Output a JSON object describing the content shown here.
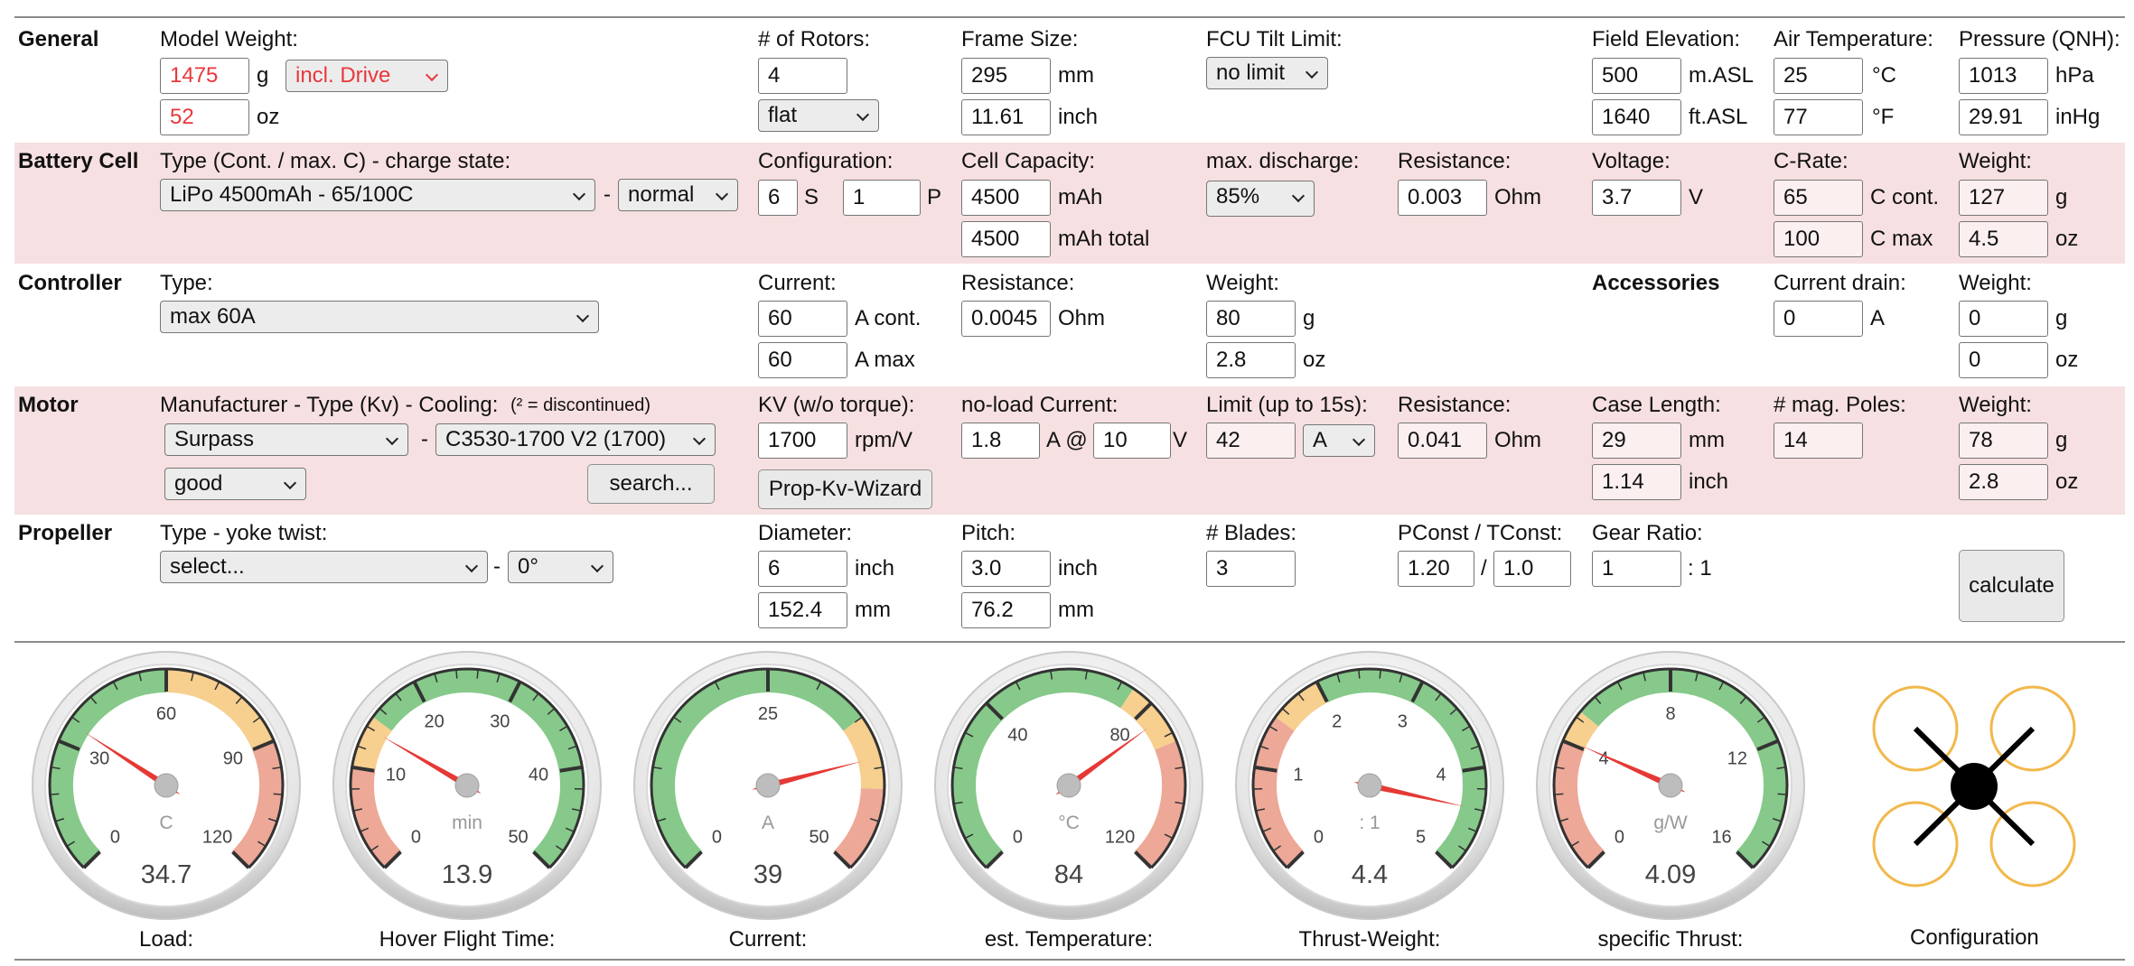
{
  "general": {
    "section": "General",
    "model_weight_label": "Model Weight:",
    "weight_g": "1475",
    "unit_g": "g",
    "drive_select": "incl. Drive",
    "weight_oz": "52",
    "unit_oz": "oz",
    "rotors_label": "# of Rotors:",
    "rotors": "4",
    "arrangement": "flat",
    "frame_label": "Frame Size:",
    "frame_mm": "295",
    "unit_mm": "mm",
    "frame_inch": "11.61",
    "unit_inch": "inch",
    "tilt_label": "FCU Tilt Limit:",
    "tilt": "no limit",
    "elev_label": "Field Elevation:",
    "elev_m": "500",
    "unit_m": "m.ASL",
    "elev_ft": "1640",
    "unit_ft": "ft.ASL",
    "temp_label": "Air Temperature:",
    "temp_c": "25",
    "unit_c": "°C",
    "temp_f": "77",
    "unit_f": "°F",
    "press_label": "Pressure (QNH):",
    "press_hpa": "1013",
    "unit_hpa": "hPa",
    "press_inhg": "29.91",
    "unit_inhg": "inHg"
  },
  "battery": {
    "section": "Battery Cell",
    "type_label": "Type (Cont. / max. C) - charge state:",
    "type": "LiPo 4500mAh - 65/100C",
    "dash": "-",
    "state": "normal",
    "config_label": "Configuration:",
    "s": "6",
    "s_unit": "S",
    "p": "1",
    "p_unit": "P",
    "cap_label": "Cell Capacity:",
    "cap": "4500",
    "cap_unit": "mAh",
    "cap_total": "4500",
    "cap_total_unit": "mAh total",
    "discharge_label": "max. discharge:",
    "discharge": "85%",
    "res_label": "Resistance:",
    "res": "0.003",
    "res_unit": "Ohm",
    "volt_label": "Voltage:",
    "volt": "3.7",
    "volt_unit": "V",
    "crate_label": "C-Rate:",
    "c_cont": "65",
    "c_cont_unit": "C cont.",
    "c_max": "100",
    "c_max_unit": "C max",
    "weight_label": "Weight:",
    "weight_g": "127",
    "unit_g": "g",
    "weight_oz": "4.5",
    "unit_oz": "oz"
  },
  "controller": {
    "section": "Controller",
    "type_label": "Type:",
    "type": "max 60A",
    "current_label": "Current:",
    "cont": "60",
    "cont_unit": "A cont.",
    "max": "60",
    "max_unit": "A max",
    "res_label": "Resistance:",
    "res": "0.0045",
    "res_unit": "Ohm",
    "weight_label": "Weight:",
    "weight_g": "80",
    "unit_g": "g",
    "weight_oz": "2.8",
    "unit_oz": "oz",
    "acc_section": "Accessories",
    "drain_label": "Current drain:",
    "drain": "0",
    "drain_unit": "A",
    "acc_weight_label": "Weight:",
    "acc_weight_g": "0",
    "acc_unit_g": "g",
    "acc_weight_oz": "0",
    "acc_unit_oz": "oz"
  },
  "motor": {
    "section": "Motor",
    "type_label": "Manufacturer - Type (Kv) - Cooling:",
    "discontinued_note": "(² = discontinued)",
    "manufacturer": "Surpass",
    "dash": "-",
    "type": "C3530-1700 V2 (1700)",
    "cooling": "good",
    "search_button": "search...",
    "kv_label": "KV (w/o torque):",
    "kv": "1700",
    "kv_unit": "rpm/V",
    "prop_kv_wizard": "Prop-Kv-Wizard",
    "noload_label": "no-load Current:",
    "noload": "1.8",
    "noload_at": "A @",
    "noload_v": "10",
    "noload_v_unit": "V",
    "limit_label": "Limit (up to 15s):",
    "limit": "42",
    "limit_unit": "A",
    "res_label": "Resistance:",
    "res": "0.041",
    "res_unit": "Ohm",
    "case_label": "Case Length:",
    "case_mm": "29",
    "unit_mm": "mm",
    "case_inch": "1.14",
    "unit_inch": "inch",
    "poles_label": "# mag. Poles:",
    "poles": "14",
    "weight_label": "Weight:",
    "weight_g": "78",
    "unit_g": "g",
    "weight_oz": "2.8",
    "unit_oz": "oz"
  },
  "propeller": {
    "section": "Propeller",
    "type_label": "Type - yoke twist:",
    "type": "select...",
    "dash": "-",
    "twist": "0°",
    "diam_label": "Diameter:",
    "diam_inch": "6",
    "unit_inch": "inch",
    "diam_mm": "152.4",
    "unit_mm": "mm",
    "pitch_label": "Pitch:",
    "pitch_inch": "3.0",
    "pitch_mm": "76.2",
    "blades_label": "# Blades:",
    "blades": "3",
    "pconst_label": "PConst / TConst:",
    "pconst": "1.20",
    "slash": "/",
    "tconst": "1.0",
    "gear_label": "Gear Ratio:",
    "gear": "1",
    "gear_unit": ": 1",
    "calculate": "calculate"
  },
  "gauges": [
    {
      "label": "Load:",
      "unit": "C",
      "value": "34.7",
      "val": 34.7,
      "min": 0,
      "max": 120,
      "ticks": [
        0,
        30,
        60,
        90,
        120
      ],
      "bands": [
        {
          "from": 0,
          "to": 60,
          "color": "#86c98a"
        },
        {
          "from": 60,
          "to": 90,
          "color": "#f7cf8f"
        },
        {
          "from": 90,
          "to": 120,
          "color": "#eda898"
        }
      ]
    },
    {
      "label": "Hover Flight Time:",
      "unit": "min",
      "value": "13.9",
      "val": 13.9,
      "min": 0,
      "max": 50,
      "ticks": [
        0,
        10,
        20,
        30,
        40,
        50
      ],
      "bands": [
        {
          "from": 0,
          "to": 10,
          "color": "#eda898"
        },
        {
          "from": 10,
          "to": 15,
          "color": "#f7cf8f"
        },
        {
          "from": 15,
          "to": 50,
          "color": "#86c98a"
        }
      ]
    },
    {
      "label": "Current:",
      "unit": "A",
      "value": "39",
      "val": 39,
      "min": 0,
      "max": 50,
      "ticks": [
        0,
        25,
        50
      ],
      "bands": [
        {
          "from": 0,
          "to": 35,
          "color": "#86c98a"
        },
        {
          "from": 35,
          "to": 42,
          "color": "#f7cf8f"
        },
        {
          "from": 42,
          "to": 50,
          "color": "#eda898"
        }
      ]
    },
    {
      "label": "est. Temperature:",
      "unit": "°C",
      "value": "84",
      "val": 84,
      "min": 0,
      "max": 120,
      "ticks": [
        0,
        40,
        80,
        120
      ],
      "bands": [
        {
          "from": 0,
          "to": 75,
          "color": "#86c98a"
        },
        {
          "from": 75,
          "to": 90,
          "color": "#f7cf8f"
        },
        {
          "from": 90,
          "to": 120,
          "color": "#eda898"
        }
      ]
    },
    {
      "label": "Thrust-Weight:",
      "unit": ": 1",
      "value": "4.4",
      "val": 4.4,
      "min": 0,
      "max": 5,
      "ticks": [
        0,
        1,
        2,
        3,
        4,
        5
      ],
      "bands": [
        {
          "from": 0,
          "to": 1.5,
          "color": "#eda898"
        },
        {
          "from": 1.5,
          "to": 2,
          "color": "#f7cf8f"
        },
        {
          "from": 2,
          "to": 5,
          "color": "#86c98a"
        }
      ]
    },
    {
      "label": "specific Thrust:",
      "unit": "g/W",
      "value": "4.09",
      "val": 4.09,
      "min": 0,
      "max": 16,
      "ticks": [
        0,
        4,
        8,
        12,
        16
      ],
      "bands": [
        {
          "from": 0,
          "to": 4,
          "color": "#eda898"
        },
        {
          "from": 4,
          "to": 5,
          "color": "#f7cf8f"
        },
        {
          "from": 5,
          "to": 16,
          "color": "#86c98a"
        }
      ]
    }
  ],
  "configuration": {
    "label": "Configuration"
  }
}
